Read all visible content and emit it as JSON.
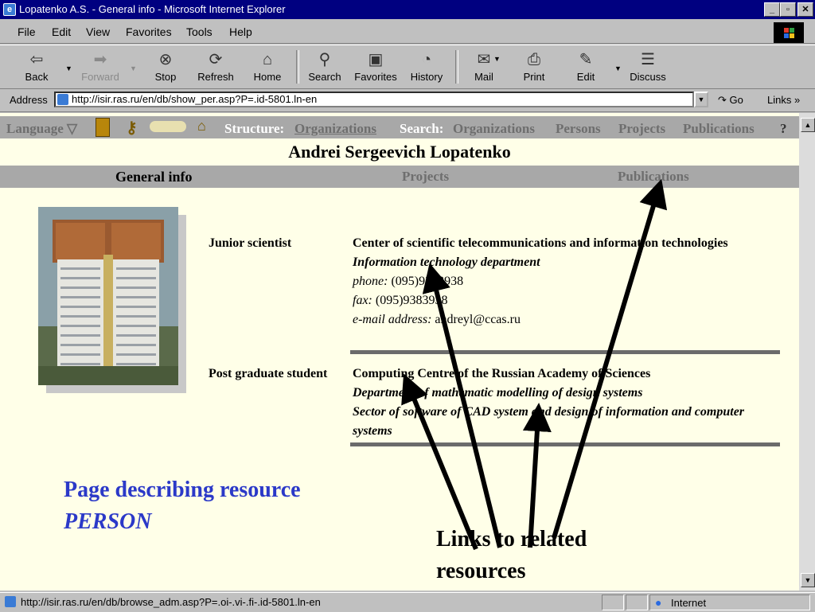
{
  "window": {
    "title": "Lopatenko A.S. - General info - Microsoft Internet Explorer"
  },
  "menu": [
    "File",
    "Edit",
    "View",
    "Favorites",
    "Tools",
    "Help"
  ],
  "toolbar": [
    {
      "label": "Back",
      "icon": "back-arrow-icon"
    },
    {
      "label": "Forward",
      "icon": "forward-arrow-icon"
    },
    {
      "label": "Stop",
      "icon": "stop-icon"
    },
    {
      "label": "Refresh",
      "icon": "refresh-icon"
    },
    {
      "label": "Home",
      "icon": "home-icon"
    },
    {
      "label": "Search",
      "icon": "search-icon"
    },
    {
      "label": "Favorites",
      "icon": "favorites-icon"
    },
    {
      "label": "History",
      "icon": "history-icon"
    },
    {
      "label": "Mail",
      "icon": "mail-icon"
    },
    {
      "label": "Print",
      "icon": "print-icon"
    },
    {
      "label": "Edit",
      "icon": "edit-icon"
    },
    {
      "label": "Discuss",
      "icon": "discuss-icon"
    }
  ],
  "address": {
    "label": "Address",
    "url": "http://isir.ras.ru/en/db/show_per.asp?P=.id-5801.ln-en",
    "go": "Go",
    "links": "Links"
  },
  "nav": {
    "language": "Language",
    "structure_label": "Structure:",
    "structure_link": "Organizations",
    "search_label": "Search:",
    "search_links": [
      "Organizations",
      "Persons",
      "Projects",
      "Publications"
    ],
    "help": "?"
  },
  "person": {
    "name": "Andrei Sergeevich Lopatenko"
  },
  "tabs": [
    "General info",
    "Projects",
    "Publications"
  ],
  "positions": [
    {
      "title": "Junior scientist",
      "org": "Center of scientific telecommunications and information technologies",
      "dept": "Information technology department",
      "phone_label": "phone:",
      "phone": "(095)9383938",
      "fax_label": "fax:",
      "fax": "(095)9383938",
      "email_label": "e-mail address:",
      "email": "andreyl@ccas.ru"
    },
    {
      "title": "Post graduate student",
      "org": "Computing Centre of the Russian Academy of Sciences",
      "dept": "Department of mathematic modelling of design systems",
      "sector": "Sector of software of CAD system and design of information and computer systems"
    }
  ],
  "annotations": {
    "caption_line1": "Page describing resource",
    "caption_line2": "PERSON",
    "links_caption": "Links to related resources"
  },
  "status": {
    "url": "http://isir.ras.ru/en/db/browse_adm.asp?P=.oi-.vi-.fi-.id-5801.ln-en",
    "zone": "Internet"
  },
  "colors": {
    "nav_strip": "#a8a8a8",
    "page_bg": "#ffffe8",
    "caption_blue": "#2b39c8",
    "title_bar": "#000080"
  }
}
